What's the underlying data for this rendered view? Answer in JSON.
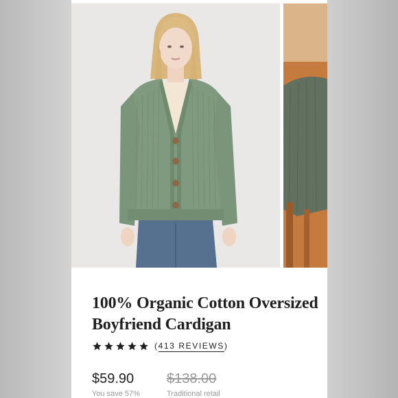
{
  "product": {
    "title": "100% Organic Cotton Oversized Boyfriend Cardigan",
    "rating": {
      "stars": 5,
      "open_paren": "(",
      "count_text": "413 REVIEWS",
      "close_paren": ")"
    },
    "price": "$59.90",
    "original_price": "$138.00",
    "savings_text": "You save 57%",
    "original_price_label": "Traditional retail"
  },
  "colors": {
    "cardigan": "#7f9a7f",
    "text": "#1f1f1f",
    "muted": "#9a9a9a"
  },
  "icons": [
    "star-icon"
  ]
}
